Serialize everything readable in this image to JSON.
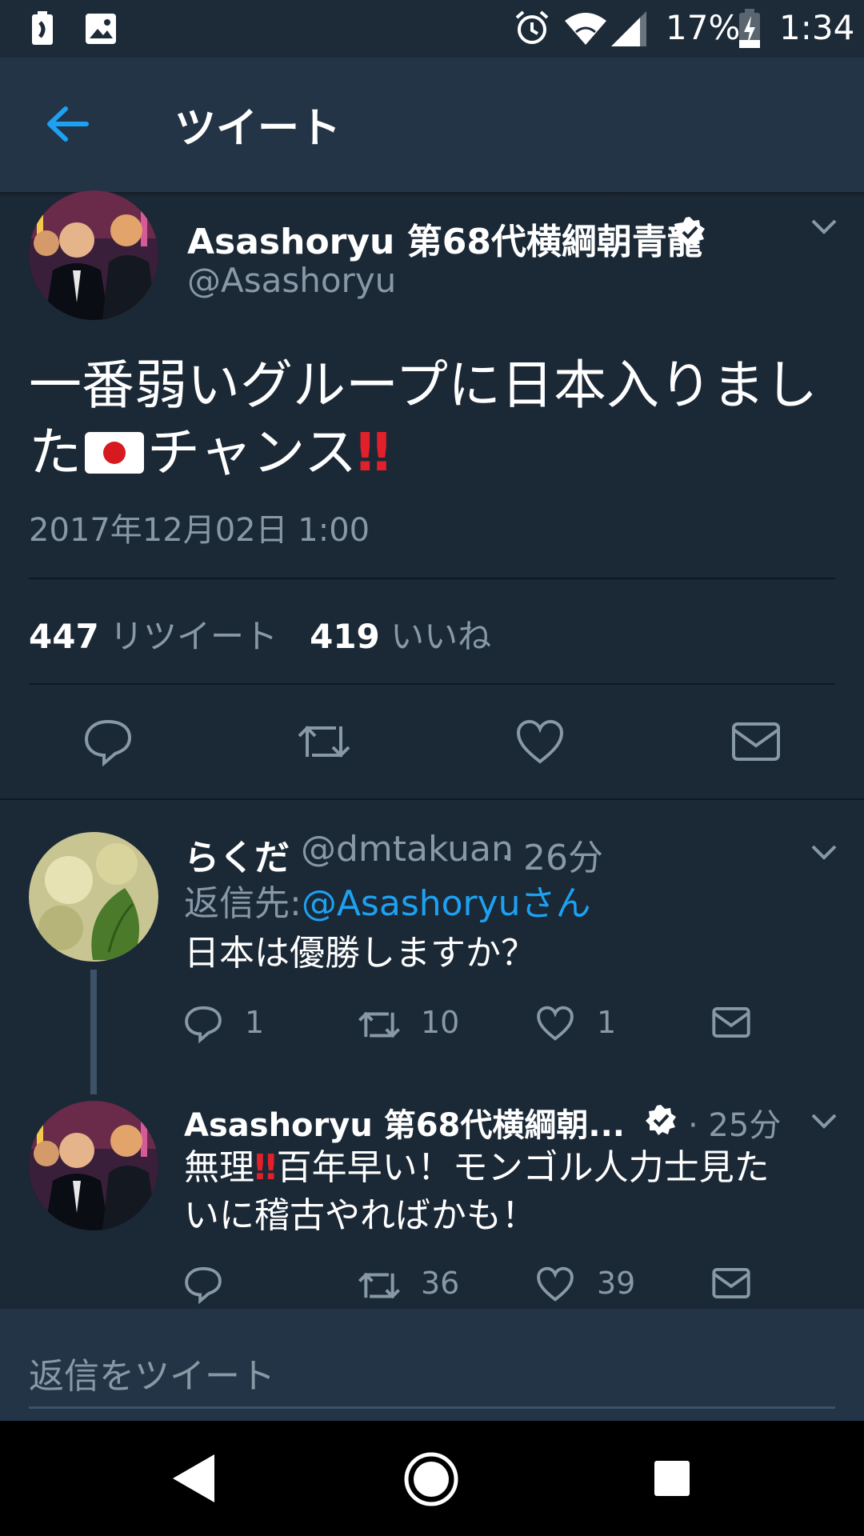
{
  "status_bar": {
    "battery_percent": "17%",
    "time": "1:34"
  },
  "app_bar": {
    "title": "ツイート"
  },
  "tweet": {
    "name": "Asashoryu 第68代横綱朝青龍",
    "handle": "@Asashoryu",
    "text_before_flag": "一番弱いグループに日本入りました",
    "text_after_flag": "チャンス",
    "text_emphasis": "‼",
    "timestamp": "2017年12月02日 1:00",
    "retweet_count": "447",
    "retweet_label": "リツイート",
    "like_count": "419",
    "like_label": "いいね"
  },
  "replies": [
    {
      "name": "らくだ",
      "handle": "@dmtakuan",
      "time": "· 26分",
      "reply_to_label": "返信先:",
      "reply_to_handle": "@Asashoryuさん",
      "text": "日本は優勝しますか？",
      "reply_count": "1",
      "retweet_count": "10",
      "like_count": "1"
    },
    {
      "name": "Asashoryu 第68代横綱朝...",
      "time": "· 25分",
      "text_part1": "無理",
      "text_emphasis": "‼",
      "text_part2": "百年早い！モンゴル人力士見た",
      "text_line2": "いに稽古やればかも！",
      "reply_count": "",
      "retweet_count": "36",
      "like_count": "39"
    }
  ],
  "composer": {
    "placeholder": "返信をツイート"
  },
  "colors": {
    "background": "#1b2836",
    "header": "#243447",
    "accent": "#1da1f2",
    "muted": "#8899a6"
  }
}
